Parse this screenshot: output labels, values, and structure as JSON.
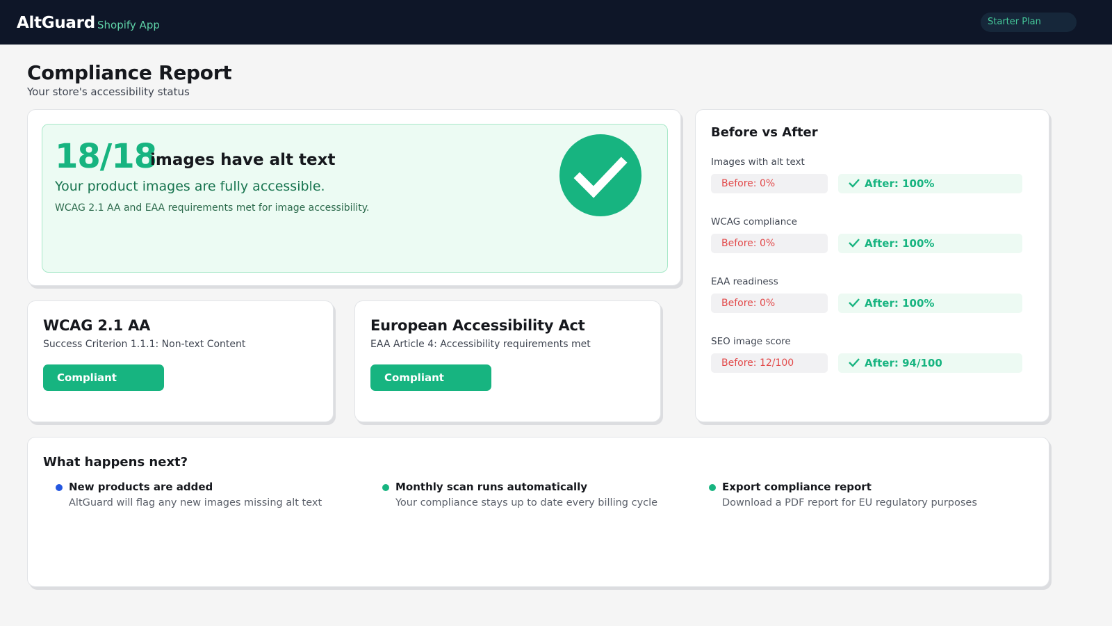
{
  "header": {
    "brand": "AltGuard",
    "brand_sub": "Shopify App",
    "plan": "Starter Plan"
  },
  "page": {
    "title": "Compliance Report",
    "subtitle": "Your store's accessibility status"
  },
  "hero": {
    "count": "18/18",
    "count_label": "images have alt text",
    "headline": "Your product images are fully accessible.",
    "note": "WCAG 2.1 AA and EAA requirements met for image accessibility.",
    "icon": "check-circle-icon"
  },
  "standards": [
    {
      "title": "WCAG 2.1 AA",
      "subtitle": "Success Criterion 1.1.1: Non-text Content",
      "status": "Compliant"
    },
    {
      "title": "European Accessibility Act",
      "subtitle": "EAA Article 4: Accessibility requirements met",
      "status": "Compliant"
    }
  ],
  "before_after": {
    "title": "Before vs After",
    "rows": [
      {
        "label": "Images with alt text",
        "before": "Before: 0%",
        "after": "After: 100%"
      },
      {
        "label": "WCAG compliance",
        "before": "Before: 0%",
        "after": "After: 100%"
      },
      {
        "label": "EAA readiness",
        "before": "Before: 0%",
        "after": "After: 100%"
      },
      {
        "label": "SEO image score",
        "before": "Before: 12/100",
        "after": "After: 94/100"
      }
    ]
  },
  "next": {
    "title": "What happens next?",
    "items": [
      {
        "title": "New products are added",
        "desc": "AltGuard will flag any new images missing alt text",
        "dot_color": "#2457e0"
      },
      {
        "title": "Monthly scan runs automatically",
        "desc": "Your compliance stays up to date every billing cycle",
        "dot_color": "#17b480"
      },
      {
        "title": "Export compliance report",
        "desc": "Download a PDF report for EU regulatory purposes",
        "dot_color": "#17b480"
      }
    ]
  },
  "colors": {
    "accent_green": "#17b480",
    "header_bg": "#0e1628",
    "before_red": "#e24a4a"
  }
}
